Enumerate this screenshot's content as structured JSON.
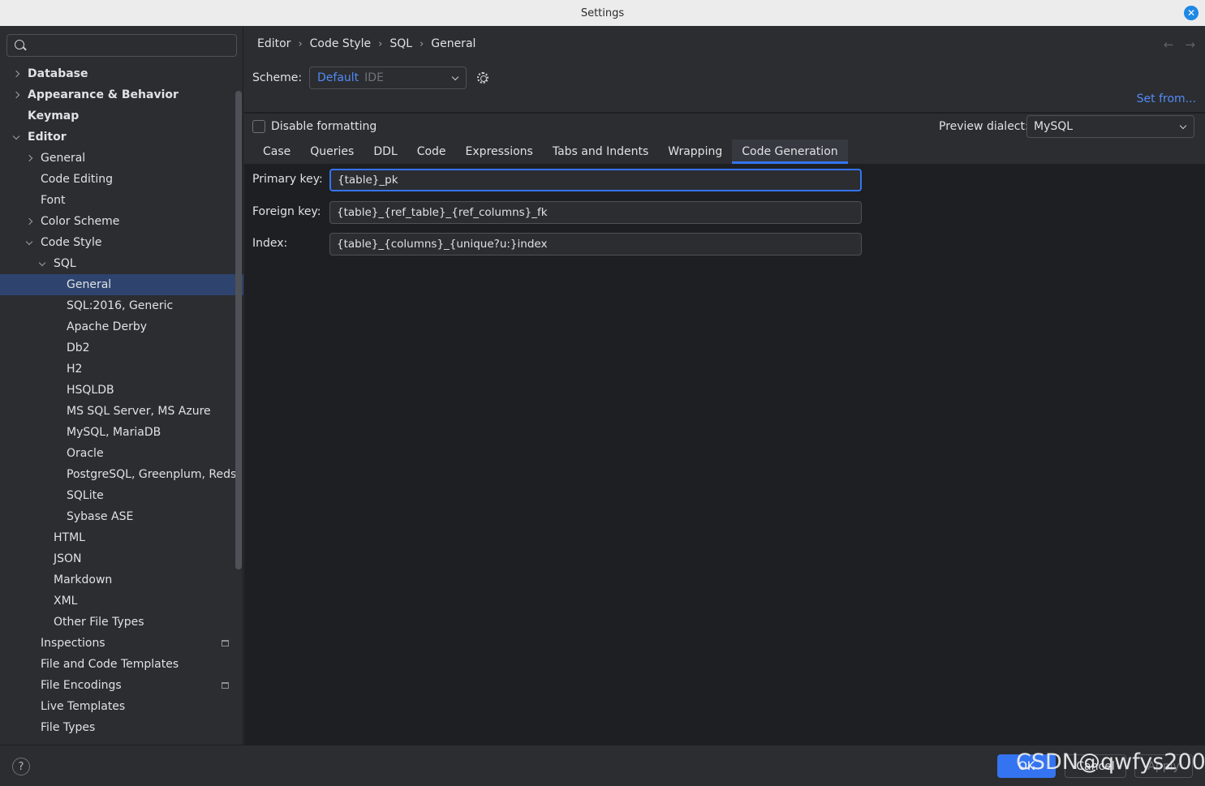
{
  "window": {
    "title": "Settings"
  },
  "sidebar": {
    "search_placeholder": "",
    "items": [
      {
        "label": "Database",
        "chevron": "right",
        "bold": true
      },
      {
        "label": "Appearance & Behavior",
        "chevron": "right",
        "bold": true
      },
      {
        "label": "Keymap",
        "chevron": "none",
        "bold": true
      },
      {
        "label": "Editor",
        "chevron": "down",
        "bold": true
      },
      {
        "label": "General",
        "chevron": "right",
        "bold": false
      },
      {
        "label": "Code Editing",
        "chevron": "none",
        "bold": false
      },
      {
        "label": "Font",
        "chevron": "none",
        "bold": false
      },
      {
        "label": "Color Scheme",
        "chevron": "right",
        "bold": false
      },
      {
        "label": "Code Style",
        "chevron": "down",
        "bold": false
      },
      {
        "label": "SQL",
        "chevron": "down",
        "bold": false
      },
      {
        "label": "General",
        "chevron": "none",
        "bold": false,
        "selected": true
      },
      {
        "label": "SQL:2016, Generic",
        "chevron": "none",
        "bold": false
      },
      {
        "label": "Apache Derby",
        "chevron": "none",
        "bold": false
      },
      {
        "label": "Db2",
        "chevron": "none",
        "bold": false
      },
      {
        "label": "H2",
        "chevron": "none",
        "bold": false
      },
      {
        "label": "HSQLDB",
        "chevron": "none",
        "bold": false
      },
      {
        "label": "MS SQL Server, MS Azure",
        "chevron": "none",
        "bold": false
      },
      {
        "label": "MySQL, MariaDB",
        "chevron": "none",
        "bold": false
      },
      {
        "label": "Oracle",
        "chevron": "none",
        "bold": false
      },
      {
        "label": "PostgreSQL, Greenplum, Reds",
        "chevron": "none",
        "bold": false
      },
      {
        "label": "SQLite",
        "chevron": "none",
        "bold": false
      },
      {
        "label": "Sybase ASE",
        "chevron": "none",
        "bold": false
      },
      {
        "label": "HTML",
        "chevron": "none",
        "bold": false
      },
      {
        "label": "JSON",
        "chevron": "none",
        "bold": false
      },
      {
        "label": "Markdown",
        "chevron": "none",
        "bold": false
      },
      {
        "label": "XML",
        "chevron": "none",
        "bold": false
      },
      {
        "label": "Other File Types",
        "chevron": "none",
        "bold": false
      },
      {
        "label": "Inspections",
        "chevron": "none",
        "bold": false,
        "project_icon": true
      },
      {
        "label": "File and Code Templates",
        "chevron": "none",
        "bold": false
      },
      {
        "label": "File Encodings",
        "chevron": "none",
        "bold": false,
        "project_icon": true
      },
      {
        "label": "Live Templates",
        "chevron": "none",
        "bold": false
      },
      {
        "label": "File Types",
        "chevron": "none",
        "bold": false
      }
    ]
  },
  "breadcrumb": [
    "Editor",
    "Code Style",
    "SQL",
    "General"
  ],
  "scheme": {
    "label": "Scheme:",
    "value": "Default",
    "suffix": "IDE"
  },
  "set_from": "Set from...",
  "disable_formatting": {
    "label": "Disable formatting",
    "checked": false
  },
  "preview_dialect": {
    "label": "Preview dialect:",
    "value": "MySQL"
  },
  "tabs": [
    {
      "label": "Case"
    },
    {
      "label": "Queries"
    },
    {
      "label": "DDL"
    },
    {
      "label": "Code"
    },
    {
      "label": "Expressions"
    },
    {
      "label": "Tabs and Indents"
    },
    {
      "label": "Wrapping"
    },
    {
      "label": "Code Generation",
      "active": true
    }
  ],
  "form": {
    "primary_key": {
      "label": "Primary key:",
      "value": "{table}_pk"
    },
    "foreign_key": {
      "label": "Foreign key:",
      "value": "{table}_{ref_table}_{ref_columns}_fk"
    },
    "index": {
      "label": "Index:",
      "value": "{table}_{columns}_{unique?u:}index"
    }
  },
  "buttons": {
    "help": "?",
    "ok": "OK",
    "cancel": "Cancel",
    "apply": "Apply"
  },
  "watermark": "CSDN@qwfys200",
  "colors": {
    "accent": "#3574f0",
    "selected_bg": "#2e436e",
    "link": "#548af7"
  }
}
